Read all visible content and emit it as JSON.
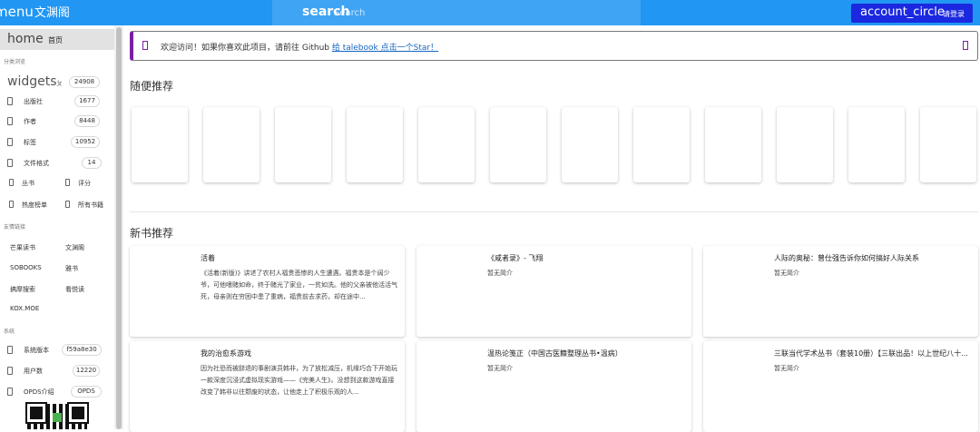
{
  "topbar": {
    "menu_icon": "menu",
    "app_title": "文渊阁",
    "search_icon": "search",
    "search_placeholder": "Search",
    "account_icon": "account_circle",
    "login_label": "请登录"
  },
  "sidebar": {
    "home_icon": "home",
    "home_label": "首页",
    "section_browse": "分类浏览",
    "widgets_icon": "widgets",
    "widgets_suffix": "ㄆ",
    "widgets_count": "24908",
    "items": [
      {
        "label": "出版社",
        "count": "1677"
      },
      {
        "label": "作者",
        "count": "8448"
      },
      {
        "label": "标签",
        "count": "10952"
      },
      {
        "label": "文件格式",
        "count": "14"
      }
    ],
    "pairs": [
      {
        "left": "丛书",
        "right": "评分"
      },
      {
        "left": "热度榜单",
        "right": "所有书籍"
      }
    ],
    "section_friends": "友情链接",
    "friends": [
      {
        "left": "芒果读书",
        "right": "文渊阁"
      },
      {
        "left": "SOBOOKS",
        "right": "雅书"
      },
      {
        "left": "搞摩搜索",
        "right": "看悦读"
      },
      {
        "left": "KOX.MOE",
        "right": ""
      }
    ],
    "section_system": "系统",
    "system": [
      {
        "label": "系统版本",
        "value": "f59a8e30"
      },
      {
        "label": "用户数",
        "value": "12220"
      },
      {
        "label": "OPDS介绍",
        "value": "OPDS"
      }
    ]
  },
  "alert": {
    "text": "欢迎访问！如果你喜欢此项目，请前往 Github ",
    "link": "给 talebook 点击一个Star！"
  },
  "random_section": {
    "title": "随便推荐",
    "card_count": 12
  },
  "new_section": {
    "title": "新书推荐",
    "books": [
      {
        "title": "活着",
        "desc": "《活着(新版)》讲述了农村人福贵悲惨的人生遭遇。福贵本是个阔少爷，可他嗜赌如命，终于赌光了家业，一贫如洗。他的父亲被他活活气死，母亲则在穷困中患了重病，福贵前去求药，却在途中..."
      },
      {
        "title": "《咸者录》- 飞翔",
        "desc": "暂无简介"
      },
      {
        "title": "人际的奥秘：曾仕强告诉你如何搞好人际关系",
        "desc": "暂无简介"
      },
      {
        "title": "我的治愈系游戏",
        "desc": "因为社恐而被辞退的事剧演员韩非，为了放松减压，机缘巧合下开始玩一款深度沉浸式虚拟现实游戏——《完美人生》。没想到这款游戏直接改变了韩非以往颓废的状态，让他走上了积极乐观的人..."
      },
      {
        "title": "温热论笺正（中国古医籍整理丛书•温病）",
        "desc": "暂无简介"
      },
      {
        "title": "三联当代学术丛书（套装10册）【三联出品！以上世纪八十...",
        "desc": "暂无简介"
      }
    ]
  }
}
